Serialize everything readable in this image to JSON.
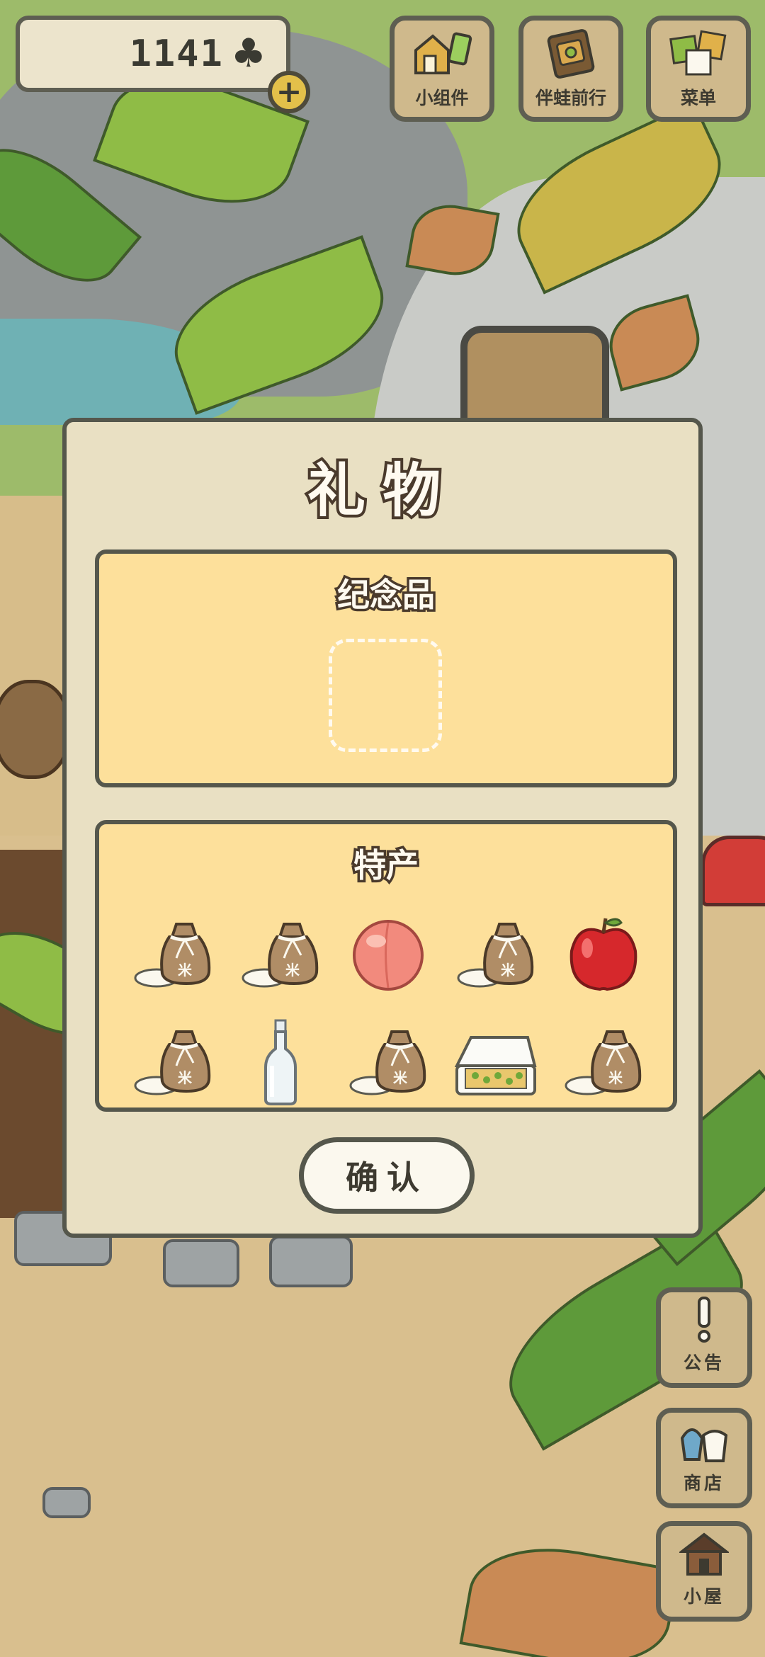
{
  "hud": {
    "clover_count": "1141",
    "clover_symbol": "♣",
    "plus_symbol": "+"
  },
  "top_buttons": {
    "widgets": "小组件",
    "travel_with": "伴蛙前行",
    "menu": "菜单"
  },
  "side_buttons": {
    "notice": "公告",
    "shop": "商店",
    "house": "小屋"
  },
  "gift_dialog": {
    "title": "礼物",
    "souvenir_title": "纪念品",
    "specialty_title": "特产",
    "specialty_items": [
      {
        "name": "rice-bag-icon"
      },
      {
        "name": "rice-bag-icon"
      },
      {
        "name": "peach-icon"
      },
      {
        "name": "rice-bag-icon"
      },
      {
        "name": "apple-icon"
      },
      {
        "name": "rice-bag-icon"
      },
      {
        "name": "glass-bottle-icon"
      },
      {
        "name": "rice-bag-icon"
      },
      {
        "name": "bento-box-icon"
      },
      {
        "name": "rice-bag-icon"
      }
    ],
    "confirm_label": "确认"
  },
  "colors": {
    "panel": "#e9e0c3",
    "section": "#fde09b",
    "border": "#55574c",
    "button_wood": "#cfb98c"
  }
}
